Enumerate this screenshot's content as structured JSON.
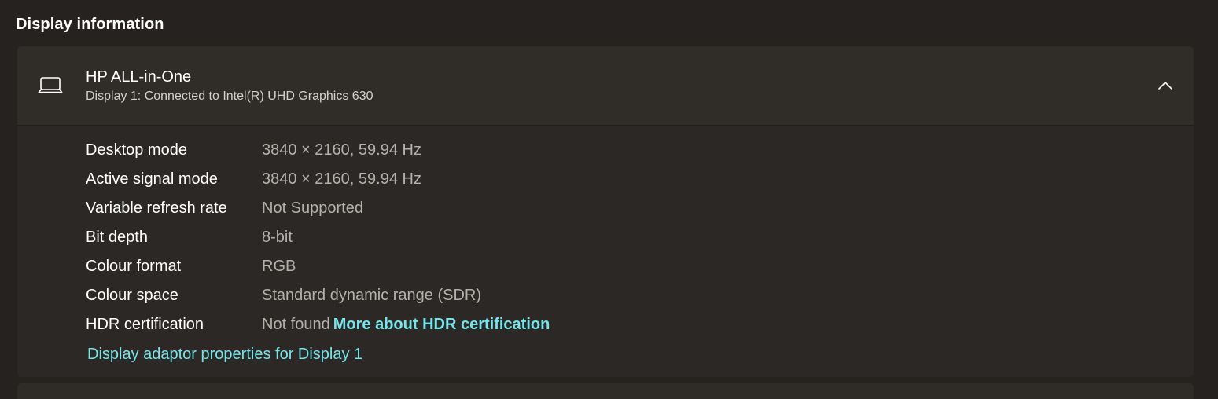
{
  "section": {
    "title": "Display information"
  },
  "display": {
    "icon": "laptop-icon",
    "name": "HP ALL-in-One",
    "subtitle": "Display 1: Connected to Intel(R) UHD Graphics 630",
    "expanded": true,
    "collapse_icon": "chevron-up-icon",
    "rows": [
      {
        "label": "Desktop mode",
        "value": "3840 × 2160, 59.94 Hz"
      },
      {
        "label": "Active signal mode",
        "value": "3840 × 2160, 59.94 Hz"
      },
      {
        "label": "Variable refresh rate",
        "value": "Not Supported"
      },
      {
        "label": "Bit depth",
        "value": "8-bit"
      },
      {
        "label": "Colour format",
        "value": "RGB"
      },
      {
        "label": "Colour space",
        "value": "Standard dynamic range (SDR)"
      },
      {
        "label": "HDR certification",
        "value": "Not found",
        "link": "More about HDR certification"
      }
    ],
    "adapter_link": "Display adaptor properties for Display 1"
  },
  "colors": {
    "background": "#25221f",
    "card": "#2b2825",
    "card_header": "#302d29",
    "accent_link": "#76e4ea",
    "secondary_text": "#b4b1ad"
  }
}
